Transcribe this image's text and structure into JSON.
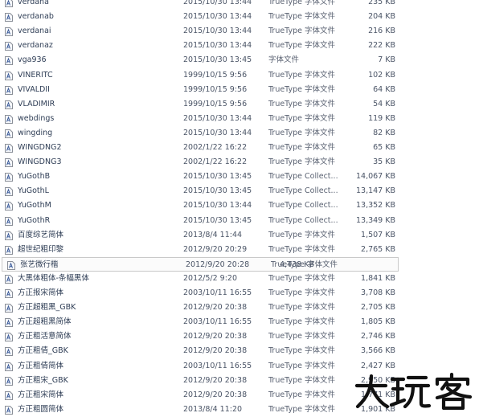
{
  "files": [
    {
      "name": "verdana",
      "date": "2015/10/30 13:44",
      "type": "TrueType 字体文件",
      "size": "235 KB"
    },
    {
      "name": "verdanab",
      "date": "2015/10/30 13:44",
      "type": "TrueType 字体文件",
      "size": "204 KB"
    },
    {
      "name": "verdanai",
      "date": "2015/10/30 13:44",
      "type": "TrueType 字体文件",
      "size": "216 KB"
    },
    {
      "name": "verdanaz",
      "date": "2015/10/30 13:44",
      "type": "TrueType 字体文件",
      "size": "222 KB"
    },
    {
      "name": "vga936",
      "date": "2015/10/30 13:45",
      "type": "字体文件",
      "size": "7 KB"
    },
    {
      "name": "VINERITC",
      "date": "1999/10/15 9:56",
      "type": "TrueType 字体文件",
      "size": "102 KB"
    },
    {
      "name": "VIVALDII",
      "date": "1999/10/15 9:56",
      "type": "TrueType 字体文件",
      "size": "64 KB"
    },
    {
      "name": "VLADIMIR",
      "date": "1999/10/15 9:56",
      "type": "TrueType 字体文件",
      "size": "54 KB"
    },
    {
      "name": "webdings",
      "date": "2015/10/30 13:44",
      "type": "TrueType 字体文件",
      "size": "119 KB"
    },
    {
      "name": "wingding",
      "date": "2015/10/30 13:44",
      "type": "TrueType 字体文件",
      "size": "82 KB"
    },
    {
      "name": "WINGDNG2",
      "date": "2002/1/22 16:22",
      "type": "TrueType 字体文件",
      "size": "65 KB"
    },
    {
      "name": "WINGDNG3",
      "date": "2002/1/22 16:22",
      "type": "TrueType 字体文件",
      "size": "35 KB"
    },
    {
      "name": "YuGothB",
      "date": "2015/10/30 13:45",
      "type": "TrueType Collect...",
      "size": "14,067 KB"
    },
    {
      "name": "YuGothL",
      "date": "2015/10/30 13:45",
      "type": "TrueType Collect...",
      "size": "13,147 KB"
    },
    {
      "name": "YuGothM",
      "date": "2015/10/30 13:44",
      "type": "TrueType Collect...",
      "size": "13,352 KB"
    },
    {
      "name": "YuGothR",
      "date": "2015/10/30 13:45",
      "type": "TrueType Collect...",
      "size": "13,349 KB"
    },
    {
      "name": "百度综艺简体",
      "date": "2013/8/4 11:44",
      "type": "TrueType 字体文件",
      "size": "1,507 KB"
    },
    {
      "name": "超世纪粗印黎",
      "date": "2012/9/20 20:29",
      "type": "TrueType 字体文件",
      "size": "2,765 KB"
    },
    {
      "name": "张艺微行楷",
      "date": "2012/9/20 20:28",
      "type": "TrueType 字体文件",
      "size": "4,438 KB"
    },
    {
      "name": "大黑体粗体-条幅黑体",
      "date": "2012/5/2 9:20",
      "type": "TrueType 字体文件",
      "size": "1,841 KB"
    },
    {
      "name": "方正报宋简体",
      "date": "2003/10/11 16:55",
      "type": "TrueType 字体文件",
      "size": "3,708 KB"
    },
    {
      "name": "方正超粗黑_GBK",
      "date": "2012/9/20 20:38",
      "type": "TrueType 字体文件",
      "size": "2,705 KB"
    },
    {
      "name": "方正超粗黑简体",
      "date": "2003/10/11 16:55",
      "type": "TrueType 字体文件",
      "size": "1,805 KB"
    },
    {
      "name": "方正粗活意简体",
      "date": "2012/9/20 20:38",
      "type": "TrueType 字体文件",
      "size": "2,746 KB"
    },
    {
      "name": "方正粗倩_GBK",
      "date": "2012/9/20 20:38",
      "type": "TrueType 字体文件",
      "size": "3,566 KB"
    },
    {
      "name": "方正粗倩简体",
      "date": "2003/10/11 16:55",
      "type": "TrueType 字体文件",
      "size": "2,427 KB"
    },
    {
      "name": "方正粗宋_GBK",
      "date": "2012/9/20 20:38",
      "type": "TrueType 字体文件",
      "size": "2,950 KB"
    },
    {
      "name": "方正粗宋简体",
      "date": "2012/9/20 20:38",
      "type": "TrueType 字体文件",
      "size": "1,771 KB"
    },
    {
      "name": "方正粗圆简体",
      "date": "2013/8/4 11:20",
      "type": "TrueType 字体文件",
      "size": "1,901 KB"
    }
  ],
  "selected_index": 18,
  "watermark": {
    "text": "大玩家"
  },
  "colors": {
    "icon_border": "#8a8f98",
    "icon_fill": "#f4f6f9",
    "icon_glyph": "#3b5b9a",
    "selection_border": "#c9c9c9"
  },
  "icons": {
    "file": "font-file-icon"
  }
}
